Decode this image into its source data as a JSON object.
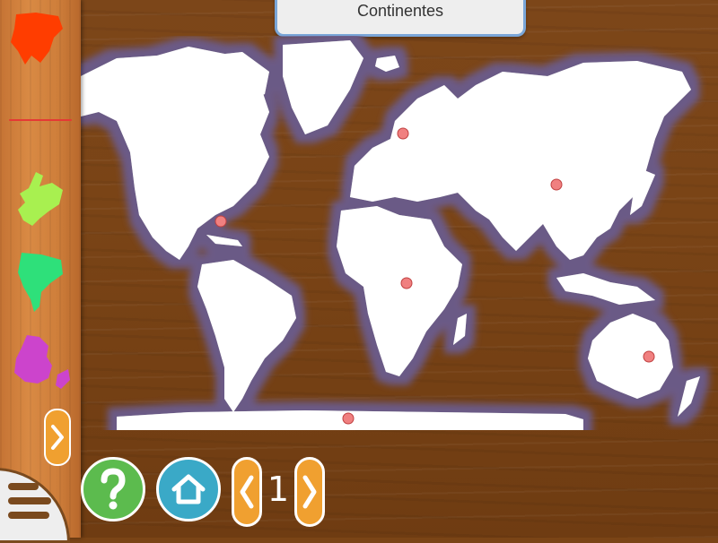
{
  "title": "Continentes",
  "page_number": "1",
  "colors": {
    "wood": "#7a4416",
    "tray": "#d98a44",
    "land": "#ffffff",
    "shadow": "#6b5a86",
    "marker": "#f08080",
    "help": "#5cbb4e",
    "home": "#3aa9c7",
    "nav": "#f0a030",
    "title_border": "#7aa6d8"
  },
  "tray_pieces": [
    {
      "name": "asia-piece",
      "color": "#ff3d00"
    },
    {
      "name": "antarctica-piece",
      "color": "#e53935"
    },
    {
      "name": "europe-piece",
      "color": "#a8f050"
    },
    {
      "name": "south-america-piece",
      "color": "#2ee07a"
    },
    {
      "name": "oceania-piece",
      "color": "#cc44cc"
    }
  ],
  "icons": {
    "help": "question-mark-icon",
    "home": "house-icon",
    "prev": "chevron-left-icon",
    "next": "chevron-right-icon",
    "menu": "hamburger-menu-icon"
  }
}
